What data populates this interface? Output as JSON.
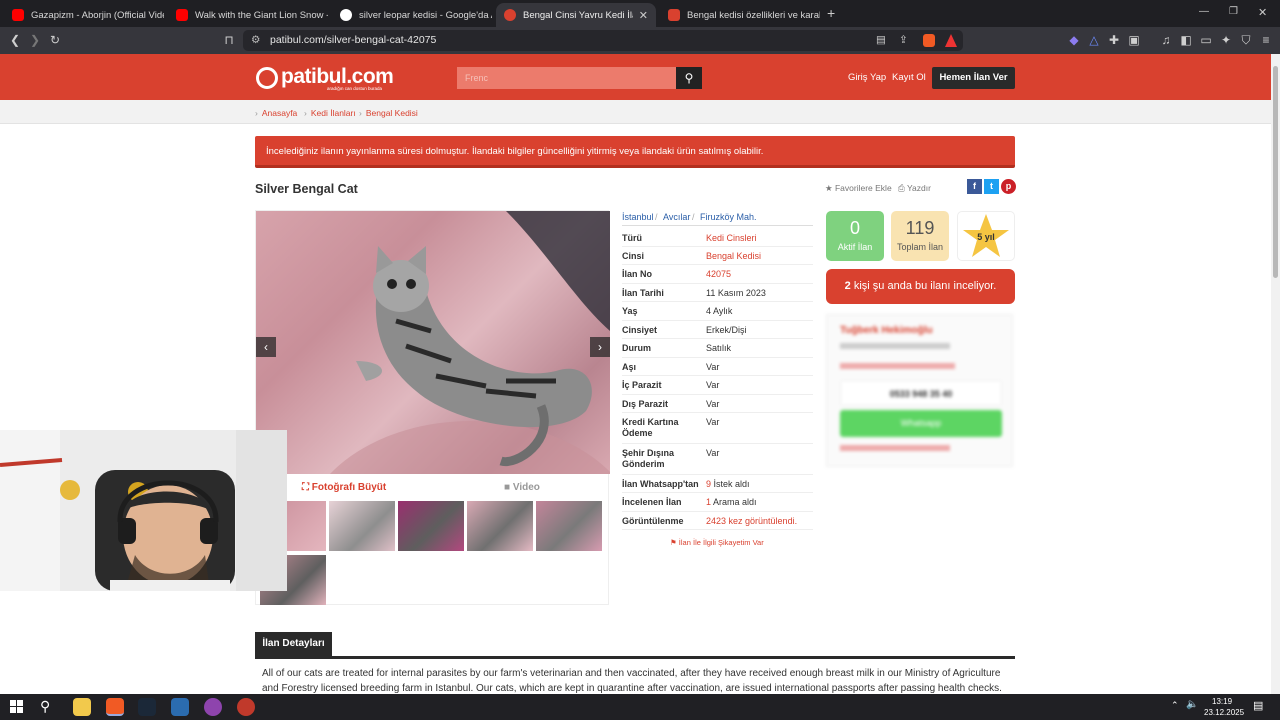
{
  "browser": {
    "tabs": [
      {
        "title": "Gazapizm - Aborjin (Official Video) -",
        "color": "#ff0000",
        "active": false
      },
      {
        "title": "Walk with the Giant Lion Snow - Dea",
        "color": "#ff0000",
        "active": false
      },
      {
        "title": "silver leopar kedisi - Google'da Ara",
        "color": "#ffffff",
        "active": false
      },
      {
        "title": "Bengal Cinsi Yavru Kedi İlanları İs",
        "color": "#d9412f",
        "active": true
      },
      {
        "title": "Bengal kedisi özellikleri ve karakteri -",
        "color": "#d9412f",
        "active": false
      }
    ],
    "url": "patibul.com/silver-bengal-cat-42075"
  },
  "header": {
    "logo": "patibul.com",
    "logo_sub": "aradığın can dostun burada",
    "search_placeholder": "Frenc",
    "login": "Giriş Yap",
    "register": "Kayıt Ol",
    "post_button": "Hemen İlan Ver",
    "brand_color": "#d9412f"
  },
  "breadcrumb": [
    "Anasayfa",
    "Kedi İlanları",
    "Bengal Kedisi"
  ],
  "alert": "İncelediğiniz ilanın yayınlanma süresi dolmuştur. İlandaki bilgiler güncelliğini yitirmiş veya ilandaki ürün satılmış olabilir.",
  "listing": {
    "title": "Silver Bengal Cat",
    "favorite": "★ Favorilere Ekle",
    "print": "Yazdır",
    "enlarge": "Fotoğrafı Büyüt",
    "video": "Video",
    "location": [
      "İstanbul",
      "Avcılar",
      "Firuzköy Mah."
    ],
    "details": [
      {
        "label": "Türü",
        "value": "Kedi Cinsleri",
        "red": true
      },
      {
        "label": "Cinsi",
        "value": "Bengal Kedisi",
        "red": true
      },
      {
        "label": "İlan No",
        "value": "42075",
        "red": true
      },
      {
        "label": "İlan Tarihi",
        "value": "11 Kasım 2023",
        "red": false
      },
      {
        "label": "Yaş",
        "value": "4 Aylık",
        "red": false
      },
      {
        "label": "Cinsiyet",
        "value": "Erkek/Dişi",
        "red": false
      },
      {
        "label": "Durum",
        "value": "Satılık",
        "red": false
      },
      {
        "label": "Aşı",
        "value": "Var",
        "red": false
      },
      {
        "label": "İç Parazit",
        "value": "Var",
        "red": false
      },
      {
        "label": "Dış Parazit",
        "value": "Var",
        "red": false
      },
      {
        "label": "Kredi Kartına Ödeme",
        "value": "Var",
        "red": false
      },
      {
        "label": "Şehir Dışına Gönderim",
        "value": "Var",
        "red": false
      }
    ],
    "whatsapp_label": "İlan Whatsapp'tan",
    "whatsapp_count": "9",
    "whatsapp_suffix": "İstek aldı",
    "calls_label": "İncelenen İlan",
    "calls_count": "1",
    "calls_suffix": "Arama aldı",
    "views_label": "Görüntülenme",
    "views_value": "2423 kez görüntülendi.",
    "complain": "⚑ İlan İle İlgili Şikayetim Var"
  },
  "seller": {
    "active_count": "0",
    "active_label": "Aktif İlan",
    "total_count": "119",
    "total_label": "Toplam İlan",
    "years": "5 yıl",
    "viewing_count": "2",
    "viewing_text": "kişi şu anda bu ilanı inceliyor.",
    "name": "Tuğberk Hekimoğlu",
    "phone": "0533 948 35 40",
    "whatsapp": "Whatsapp"
  },
  "details_tab": "İlan Detayları",
  "description": "All of our cats are treated for internal parasites by our farm's veterinarian and then vaccinated, after they have received enough breast milk in our Ministry of Agriculture and Forestry licensed breeding farm in Istanbul. Our cats, which are kept in quarantine after vaccination, are issued international passports after passing health checks. Their microchips are",
  "taskbar": {
    "time": "13:19",
    "date": "23.12.2025"
  }
}
